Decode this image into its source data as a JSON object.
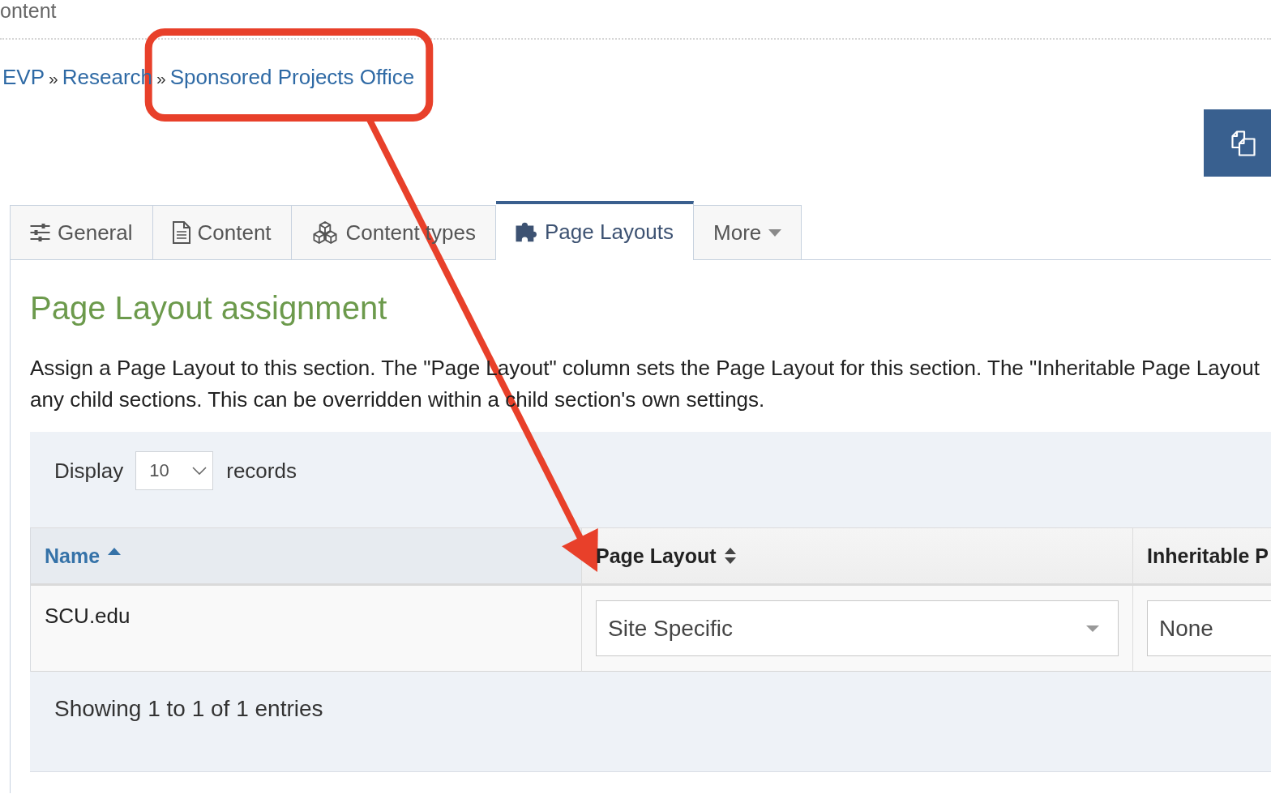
{
  "page_title": "ontent",
  "breadcrumb": [
    {
      "label": "EVP",
      "highlighted": false
    },
    {
      "separator": "»",
      "label": "Research",
      "highlighted": false
    },
    {
      "separator": "»",
      "label": "Sponsored Projects Office",
      "highlighted": true
    }
  ],
  "tabs": [
    {
      "kind": "icon",
      "label": "General",
      "selected": false
    },
    {
      "kind": "icon",
      "label": "Content",
      "selected": false
    },
    {
      "kind": "icon",
      "label": "Content types",
      "selected": false
    },
    {
      "kind": "icon",
      "label": "Page Layouts",
      "selected": true
    },
    {
      "kind": "menu",
      "label": "More",
      "selected": false
    }
  ],
  "panel": {
    "heading": "Page Layout assignment",
    "description_lines": [
      "Assign a Page Layout to this section. The \"Page Layout\" column sets the Page Layout for this section. The \"Inheritable Page Layout",
      "any child sections. This can be overridden within a child section's own settings."
    ],
    "table": {
      "length_control": {
        "label": "Display",
        "value": "10",
        "suffix": "records"
      },
      "columns": [
        {
          "label": "Name",
          "sorted": true,
          "pointed_at": false
        },
        {
          "label": "Page Layout",
          "sorted": false,
          "pointed_at": true
        },
        {
          "label": "Inheritable P",
          "pointed_at": false
        }
      ],
      "rows": [
        {
          "cells": [
            {
              "kind": "text",
              "value": "SCU.edu"
            },
            {
              "kind": "select",
              "value": "Site Specific"
            },
            {
              "kind": "select",
              "value": "None"
            }
          ]
        }
      ],
      "info": "Showing 1 to 1 of 1 entries"
    }
  }
}
